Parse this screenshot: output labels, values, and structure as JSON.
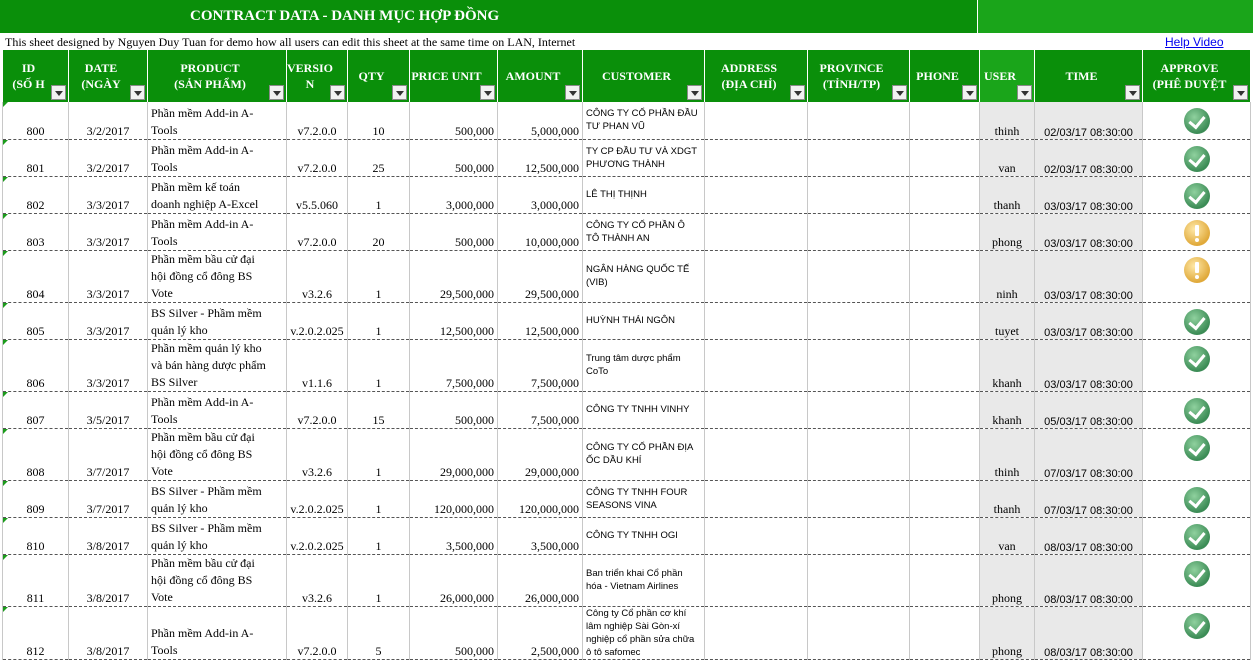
{
  "sheet": {
    "title": "CONTRACT DATA - DANH MỤC HỢP ĐỒNG",
    "note": "This sheet designed by Nguyen Duy Tuan for demo how all users can edit this sheet at the same time on LAN, Internet",
    "help_link": "Help Video"
  },
  "colors": {
    "header_green": "#0a8f0a",
    "approve_ok": "#3c8c56",
    "approve_pending": "#e0a93a"
  },
  "columns": [
    {
      "l1": "ID",
      "l2": "(SỐ H"
    },
    {
      "l1": "DATE",
      "l2": "(NGÀY"
    },
    {
      "l1": "PRODUCT",
      "l2": "(SẢN PHẨM)"
    },
    {
      "l1": "VERSIO",
      "l2": "N"
    },
    {
      "l1": "QTY",
      "l2": ""
    },
    {
      "l1": "PRICE UNIT",
      "l2": ""
    },
    {
      "l1": "AMOUNT",
      "l2": ""
    },
    {
      "l1": "CUSTOMER",
      "l2": ""
    },
    {
      "l1": "ADDRESS",
      "l2": "(ĐỊA CHỈ)"
    },
    {
      "l1": "PROVINCE",
      "l2": "(TỈNH/TP)"
    },
    {
      "l1": "PHONE",
      "l2": ""
    },
    {
      "l1": "USER",
      "l2": ""
    },
    {
      "l1": "TIME",
      "l2": ""
    },
    {
      "l1": "APPROVE",
      "l2": "(PHÊ DUYỆT"
    }
  ],
  "rows": [
    {
      "id": "800",
      "date": "3/2/2017",
      "product": [
        "Phần mềm Add-in A-",
        "Tools"
      ],
      "version": "v7.2.0.0",
      "qty": "10",
      "price": "500,000",
      "amount": "5,000,000",
      "customer": [
        "CÔNG TY CỔ PHẦN ĐẦU",
        "TƯ PHAN VŨ"
      ],
      "address": "",
      "province": "",
      "phone": "",
      "user": "thinh",
      "time": "02/03/17 08:30:00",
      "approve": "ok-icon"
    },
    {
      "id": "801",
      "date": "3/2/2017",
      "product": [
        "Phần mềm Add-in A-",
        "Tools"
      ],
      "version": "v7.2.0.0",
      "qty": "25",
      "price": "500,000",
      "amount": "12,500,000",
      "customer": [
        "TY CP ĐẦU TƯ VÀ XDGT",
        "PHƯƠNG THÀNH"
      ],
      "address": "",
      "province": "",
      "phone": "",
      "user": "van",
      "time": "02/03/17 08:30:00",
      "approve": "ok-icon"
    },
    {
      "id": "802",
      "date": "3/3/2017",
      "product": [
        "Phần mềm kế toán",
        "doanh nghiệp A-Excel"
      ],
      "version": "v5.5.060",
      "qty": "1",
      "price": "3,000,000",
      "amount": "3,000,000",
      "customer": [
        "LÊ THỊ THỊNH"
      ],
      "address": "",
      "province": "",
      "phone": "",
      "user": "thanh",
      "time": "03/03/17 08:30:00",
      "approve": "ok-icon"
    },
    {
      "id": "803",
      "date": "3/3/2017",
      "product": [
        "Phần mềm Add-in A-",
        "Tools"
      ],
      "version": "v7.2.0.0",
      "qty": "20",
      "price": "500,000",
      "amount": "10,000,000",
      "customer": [
        "CÔNG TY CỔ PHẦN Ô",
        "TÔ THÀNH AN"
      ],
      "address": "",
      "province": "",
      "phone": "",
      "user": "phong",
      "time": "03/03/17 08:30:00",
      "approve": "warning-icon"
    },
    {
      "id": "804",
      "date": "3/3/2017",
      "product": [
        "Phần mềm bầu cử đại",
        "hội đồng cổ đông BS",
        "Vote"
      ],
      "version": "v3.2.6",
      "qty": "1",
      "price": "29,500,000",
      "amount": "29,500,000",
      "customer": [
        "NGÂN HÀNG QUỐC TẾ",
        "(VIB)"
      ],
      "address": "",
      "province": "",
      "phone": "",
      "user": "ninh",
      "time": "03/03/17 08:30:00",
      "approve": "warning-icon"
    },
    {
      "id": "805",
      "date": "3/3/2017",
      "product": [
        "BS Silver - Phầm mềm",
        "quản lý kho"
      ],
      "version": "v.2.0.2.025",
      "qty": "1",
      "price": "12,500,000",
      "amount": "12,500,000",
      "customer": [
        "HUỲNH THÁI NGÔN"
      ],
      "address": "",
      "province": "",
      "phone": "",
      "user": "tuyet",
      "time": "03/03/17 08:30:00",
      "approve": "ok-icon"
    },
    {
      "id": "806",
      "date": "3/3/2017",
      "product": [
        "Phần mềm quản lý kho",
        "và bán hàng dược phẩm",
        "BS Silver"
      ],
      "version": "v1.1.6",
      "qty": "1",
      "price": "7,500,000",
      "amount": "7,500,000",
      "customer": [
        "Trung tâm dược phẩm",
        "CoTo"
      ],
      "address": "",
      "province": "",
      "phone": "",
      "user": "khanh",
      "time": "03/03/17 08:30:00",
      "approve": "ok-icon"
    },
    {
      "id": "807",
      "date": "3/5/2017",
      "product": [
        "Phần mềm Add-in A-",
        "Tools"
      ],
      "version": "v7.2.0.0",
      "qty": "15",
      "price": "500,000",
      "amount": "7,500,000",
      "customer": [
        "CÔNG TY TNHH VINHY"
      ],
      "address": "",
      "province": "",
      "phone": "",
      "user": "khanh",
      "time": "05/03/17 08:30:00",
      "approve": "ok-icon"
    },
    {
      "id": "808",
      "date": "3/7/2017",
      "product": [
        "Phần mềm bầu cử đại",
        "hội đồng cổ đông BS",
        "Vote"
      ],
      "version": "v3.2.6",
      "qty": "1",
      "price": "29,000,000",
      "amount": "29,000,000",
      "customer": [
        "CÔNG TY CỔ PHẦN ĐỊA",
        "ỐC DẦU KHÍ"
      ],
      "address": "",
      "province": "",
      "phone": "",
      "user": "thinh",
      "time": "07/03/17 08:30:00",
      "approve": "ok-icon"
    },
    {
      "id": "809",
      "date": "3/7/2017",
      "product": [
        "BS Silver - Phầm mềm",
        "quản lý kho"
      ],
      "version": "v.2.0.2.025",
      "qty": "1",
      "price": "120,000,000",
      "amount": "120,000,000",
      "customer": [
        "CÔNG TY TNHH FOUR",
        "SEASONS VINA"
      ],
      "address": "",
      "province": "",
      "phone": "",
      "user": "thanh",
      "time": "07/03/17 08:30:00",
      "approve": "ok-icon"
    },
    {
      "id": "810",
      "date": "3/8/2017",
      "product": [
        "BS Silver - Phầm mềm",
        "quản lý kho"
      ],
      "version": "v.2.0.2.025",
      "qty": "1",
      "price": "3,500,000",
      "amount": "3,500,000",
      "customer": [
        "CÔNG TY TNHH OGI"
      ],
      "address": "",
      "province": "",
      "phone": "",
      "user": "van",
      "time": "08/03/17 08:30:00",
      "approve": "ok-icon"
    },
    {
      "id": "811",
      "date": "3/8/2017",
      "product": [
        "Phần mềm bầu cử đại",
        "hội đồng cổ đông BS",
        "Vote"
      ],
      "version": "v3.2.6",
      "qty": "1",
      "price": "26,000,000",
      "amount": "26,000,000",
      "customer": [
        "Ban triển khai Cổ phần",
        "hóa - Vietnam Airlines"
      ],
      "address": "",
      "province": "",
      "phone": "",
      "user": "phong",
      "time": "08/03/17 08:30:00",
      "approve": "ok-icon"
    },
    {
      "id": "812",
      "date": "3/8/2017",
      "product": [
        "Phần mềm Add-in A-",
        "Tools"
      ],
      "version": "v7.2.0.0",
      "qty": "5",
      "price": "500,000",
      "amount": "2,500,000",
      "customer": [
        "Công ty Cổ phần cơ khí",
        "lâm nghiệp Sài Gòn-xí",
        "nghiệp cổ phần sửa chữa",
        "ô tô safomec"
      ],
      "address": "",
      "province": "",
      "phone": "",
      "user": "phong",
      "time": "08/03/17 08:30:00",
      "approve": "ok-icon"
    }
  ]
}
